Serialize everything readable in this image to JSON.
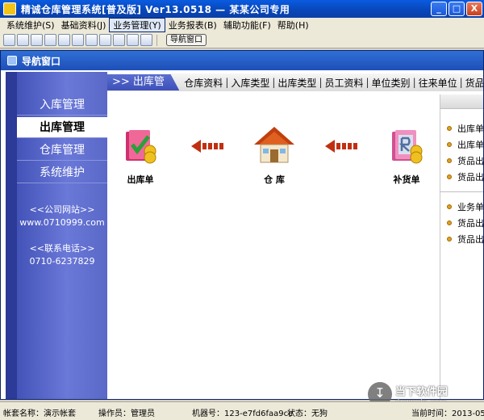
{
  "window": {
    "title": "精诚仓库管理系统[普及版] Ver13.0518 — 某某公司专用",
    "buttons": [
      "_",
      "□",
      "X"
    ]
  },
  "menubar": {
    "items": [
      {
        "label": "系统维护(S)"
      },
      {
        "label": "基础资料(J)"
      },
      {
        "label": "业务管理(Y)"
      },
      {
        "label": "业务报表(B)"
      },
      {
        "label": "辅助功能(F)"
      },
      {
        "label": "帮助(H)"
      }
    ]
  },
  "toolbar": {
    "nav_button": "导航窗口"
  },
  "nav_window": {
    "title": "导航窗口",
    "left_menu": [
      {
        "label": "入库管理"
      },
      {
        "label": "出库管理"
      },
      {
        "label": "仓库管理"
      },
      {
        "label": "系统维护"
      }
    ],
    "website_label": "<<公司网站>>",
    "website": "www.0710999.com",
    "phone_label": "<<联系电话>>",
    "phone": "0710-6237829",
    "active_tab": ">> 出库管理",
    "tabs": [
      {
        "label": "仓库资料"
      },
      {
        "label": "入库类型"
      },
      {
        "label": "出库类型"
      },
      {
        "label": "员工资料"
      },
      {
        "label": "单位类别"
      },
      {
        "label": "往来单位"
      },
      {
        "label": "货品类"
      }
    ],
    "flow": [
      {
        "label": "出库单",
        "icon": "outbound-order-icon"
      },
      {
        "label": "仓  库",
        "icon": "warehouse-house-icon"
      },
      {
        "label": "补货单",
        "icon": "replenishment-order-icon"
      }
    ],
    "right_list_1": [
      {
        "label": "出库单"
      },
      {
        "label": "出库单"
      },
      {
        "label": "货品出"
      },
      {
        "label": "货品出"
      }
    ],
    "right_list_2": [
      {
        "label": "业务单"
      },
      {
        "label": "货品出"
      },
      {
        "label": "货品出"
      }
    ]
  },
  "statusbar": {
    "account": "帐套名称：演示帐套",
    "operator": "操作员：管理员",
    "machine": "机器号：123-e7fd6faa9ce",
    "status": "状态：无狗",
    "time": "当前时间：2013-05-2"
  },
  "watermark": {
    "name": "当下软件园",
    "domain": "downxia.com"
  }
}
